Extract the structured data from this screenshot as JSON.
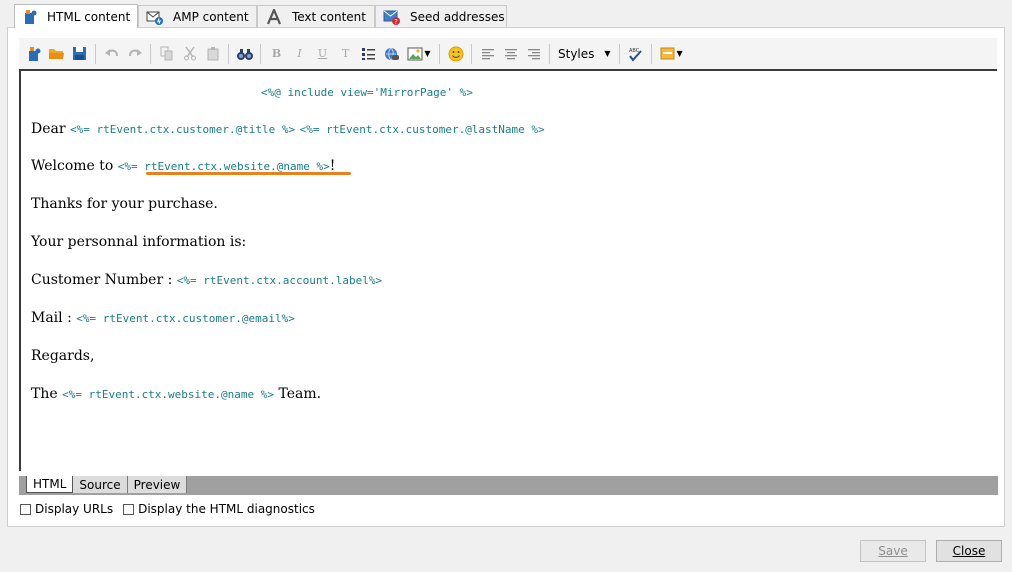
{
  "tabs": [
    {
      "label": "HTML content",
      "icon": "html-content-icon",
      "active": true
    },
    {
      "label": "AMP content",
      "icon": "amp-content-icon",
      "active": false
    },
    {
      "label": "Text content",
      "icon": "text-content-icon",
      "active": false
    },
    {
      "label": "Seed addresses",
      "icon": "seed-addresses-icon",
      "active": false
    }
  ],
  "toolbar": {
    "styles_label": "Styles",
    "bold": "B",
    "italic": "I",
    "underline": "U",
    "strike": "T"
  },
  "editor": {
    "include_line": "<%@ include view='MirrorPage' %>",
    "dear_prefix": "Dear ",
    "dear_code1": "<%= rtEvent.ctx.customer.@title %>",
    "dear_code2": "<%= rtEvent.ctx.customer.@lastName %>",
    "welcome_prefix": "Welcome to ",
    "welcome_code": "<%= rtEvent.ctx.website.@name %>",
    "welcome_suffix": "!",
    "thanks": "Thanks for your purchase.",
    "personal": "Your personnal information is:",
    "custnum_prefix": "Customer Number : ",
    "custnum_code": "<%= rtEvent.ctx.account.label%>",
    "mail_prefix": "Mail : ",
    "mail_code": "<%= rtEvent.ctx.customer.@email%>",
    "regards": "Regards,",
    "the_prefix": "The ",
    "the_code": "<%= rtEvent.ctx.website.@name %>",
    "the_suffix": " Team."
  },
  "view_tabs": [
    "HTML",
    "Source",
    "Preview"
  ],
  "options": {
    "display_urls": "Display URLs",
    "display_diagnostics": "Display the HTML diagnostics"
  },
  "buttons": {
    "save": "Save",
    "close": "Close"
  },
  "colors": {
    "code": "#1a7f86",
    "highlight": "#e8821c"
  }
}
